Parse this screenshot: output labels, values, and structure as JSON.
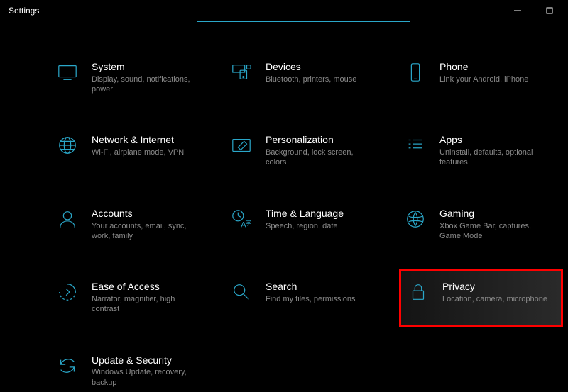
{
  "window": {
    "title": "Settings"
  },
  "accent_color": "#2aa7c9",
  "highlight_border": "#ff0000",
  "tiles": {
    "system": {
      "title": "System",
      "desc": "Display, sound, notifications, power"
    },
    "devices": {
      "title": "Devices",
      "desc": "Bluetooth, printers, mouse"
    },
    "phone": {
      "title": "Phone",
      "desc": "Link your Android, iPhone"
    },
    "network": {
      "title": "Network & Internet",
      "desc": "Wi-Fi, airplane mode, VPN"
    },
    "personalization": {
      "title": "Personalization",
      "desc": "Background, lock screen, colors"
    },
    "apps": {
      "title": "Apps",
      "desc": "Uninstall, defaults, optional features"
    },
    "accounts": {
      "title": "Accounts",
      "desc": "Your accounts, email, sync, work, family"
    },
    "time": {
      "title": "Time & Language",
      "desc": "Speech, region, date"
    },
    "gaming": {
      "title": "Gaming",
      "desc": "Xbox Game Bar, captures, Game Mode"
    },
    "ease": {
      "title": "Ease of Access",
      "desc": "Narrator, magnifier, high contrast"
    },
    "search": {
      "title": "Search",
      "desc": "Find my files, permissions"
    },
    "privacy": {
      "title": "Privacy",
      "desc": "Location, camera, microphone"
    },
    "update": {
      "title": "Update & Security",
      "desc": "Windows Update, recovery, backup"
    }
  }
}
